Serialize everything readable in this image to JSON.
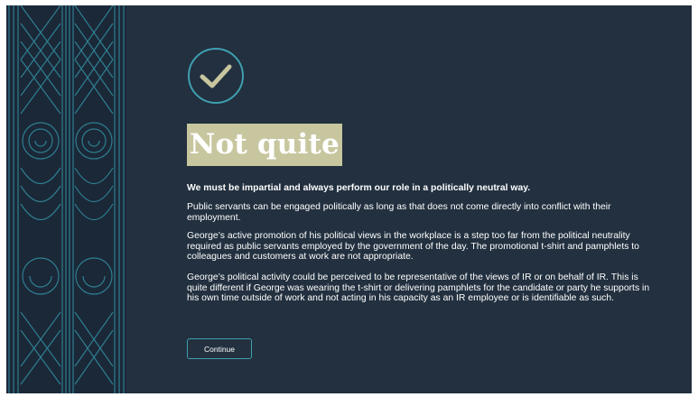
{
  "feedback": {
    "icon": "check-circle-icon",
    "title": "Not quite",
    "lead": "We must be impartial and always perform our role in a politically neutral way.",
    "paragraphs": [
      "Public servants can be engaged politically as long as that does not come directly into conflict with their employment.",
      "George’s active promotion of his political views in the workplace is a step too far from the political neutrality required as public servants employed by the government of the day. The promotional t-shirt and pamphlets to colleagues and customers at work are not appropriate.",
      "George’s political activity could be perceived to be representative of the views of IR or on behalf of IR. This is quite different if George was wearing the t-shirt or delivering pamphlets for the candidate or party he supports in his own time outside of work and not acting in his capacity as an IR employee or is identifiable as such."
    ],
    "continue_label": "Continue"
  },
  "colors": {
    "background": "#22303f",
    "pattern_bg": "#1b2838",
    "pattern_line": "#2e7f8f",
    "accent": "#3f9fb0",
    "title_highlight": "#c7c69f",
    "check": "#c7c69f"
  },
  "decor": {
    "left_panel": "maori-kowhaiwhai-pattern"
  }
}
